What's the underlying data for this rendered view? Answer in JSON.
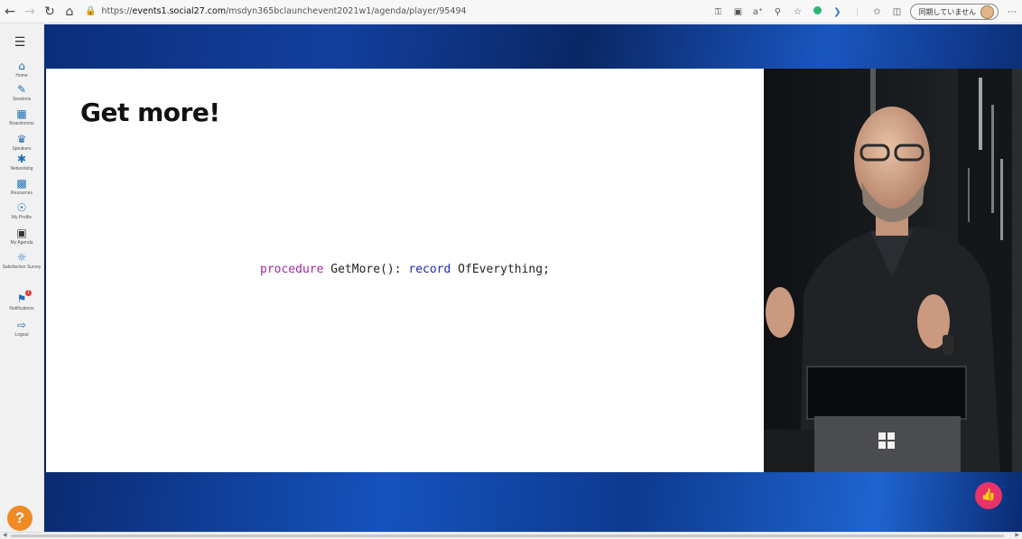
{
  "browser": {
    "url_prefix": "https://",
    "url_host": "events1.social27.com",
    "url_path": "/msdyn365bclaunchevent2021w1/agenda/player/95494",
    "sync_label": "同期していません",
    "more": "⋯"
  },
  "sidebar": {
    "items": [
      {
        "label": "Home",
        "icon": "home-icon"
      },
      {
        "label": "Sessions",
        "icon": "pen-icon"
      },
      {
        "label": "Boardrooms",
        "icon": "grid-icon"
      },
      {
        "label": "Speakers",
        "icon": "speaker-icon"
      },
      {
        "label": "Networking",
        "icon": "network-icon"
      },
      {
        "label": "Resources",
        "icon": "resource-icon"
      },
      {
        "label": "My Profile",
        "icon": "profile-icon"
      },
      {
        "label": "My Agenda",
        "icon": "calendar-icon"
      },
      {
        "label": "Satisfaction Survey",
        "icon": "survey-icon"
      },
      {
        "label": "Notifications",
        "icon": "bell-icon",
        "badge": "1"
      },
      {
        "label": "Logout",
        "icon": "logout-icon"
      }
    ],
    "help": "?"
  },
  "slide": {
    "title": "Get more!",
    "code": {
      "kw_procedure": "procedure",
      "name": " GetMore(): ",
      "kw_record": "record",
      "rest": " OfEverything;"
    }
  },
  "colors": {
    "accent": "#1f6fb8",
    "keyword_procedure": "#a626a4",
    "keyword_record": "#1f2bb8",
    "like_button": "#e8336a",
    "help_button": "#f08a24"
  }
}
